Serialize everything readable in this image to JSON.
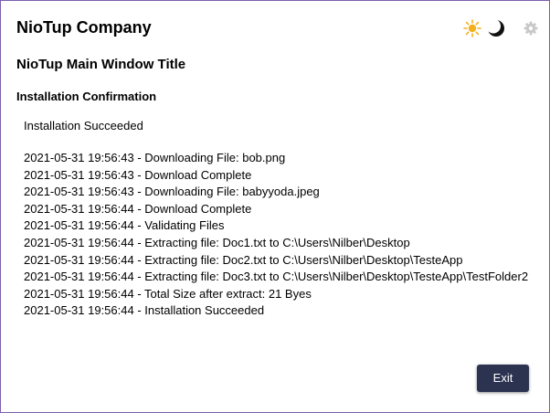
{
  "header": {
    "company": "NioTup Company",
    "main_title": "NioTup Main Window Title",
    "sub_title": "Installation Confirmation"
  },
  "theme_controls": {
    "icons": [
      "sun-icon",
      "moon-icon",
      "gear-icon"
    ],
    "sun_color": "#f2b01e",
    "moon_color": "#111111",
    "gear_color": "#c8c8c8"
  },
  "content": {
    "status": "Installation Succeeded",
    "log": [
      "2021-05-31 19:56:43 - Downloading File: bob.png",
      "2021-05-31 19:56:43 - Download Complete",
      "2021-05-31 19:56:43 - Downloading File: babyyoda.jpeg",
      "2021-05-31 19:56:44 - Download Complete",
      "2021-05-31 19:56:44 - Validating Files",
      "2021-05-31 19:56:44 - Extracting file: Doc1.txt to C:\\Users\\Nilber\\Desktop",
      "2021-05-31 19:56:44 - Extracting file: Doc2.txt to C:\\Users\\Nilber\\Desktop\\TesteApp",
      "2021-05-31 19:56:44 - Extracting file: Doc3.txt to C:\\Users\\Nilber\\Desktop\\TesteApp\\TestFolder2",
      "2021-05-31 19:56:44 - Total Size after extract: 21 Byes",
      "2021-05-31 19:56:44 - Installation Succeeded"
    ]
  },
  "footer": {
    "exit_label": "Exit",
    "exit_color": "#2b3350"
  }
}
